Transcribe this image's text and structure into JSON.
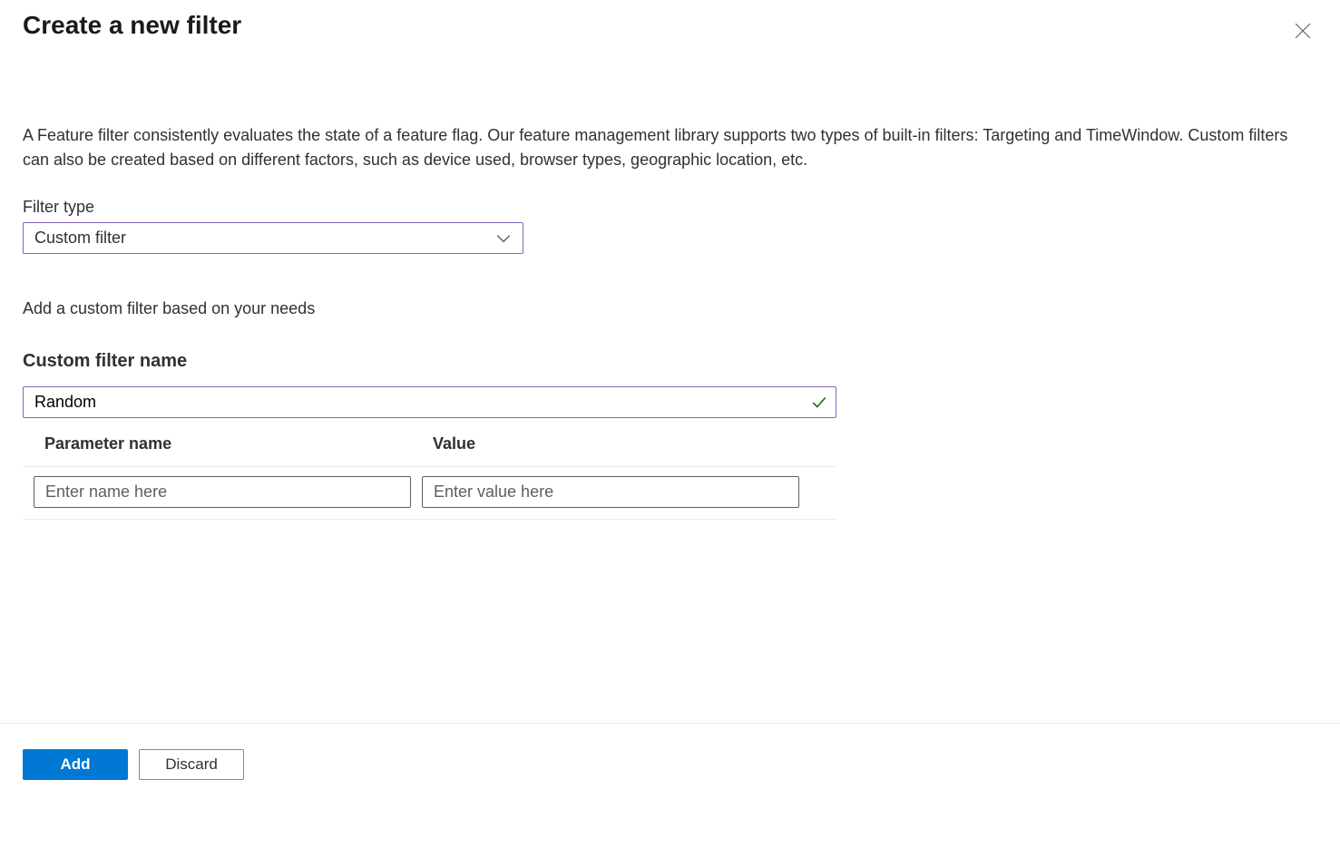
{
  "header": {
    "title": "Create a new filter"
  },
  "description": "A Feature filter consistently evaluates the state of a feature flag. Our feature management library supports two types of built-in filters: Targeting and TimeWindow. Custom filters can also be created based on different factors, such as device used, browser types, geographic location, etc.",
  "filterType": {
    "label": "Filter type",
    "selected": "Custom filter"
  },
  "helpText": "Add a custom filter based on your needs",
  "customFilterName": {
    "label": "Custom filter name",
    "value": "Random"
  },
  "paramsTable": {
    "headers": {
      "name": "Parameter name",
      "value": "Value"
    },
    "row": {
      "namePlaceholder": "Enter name here",
      "valuePlaceholder": "Enter value here"
    }
  },
  "footer": {
    "add": "Add",
    "discard": "Discard"
  }
}
